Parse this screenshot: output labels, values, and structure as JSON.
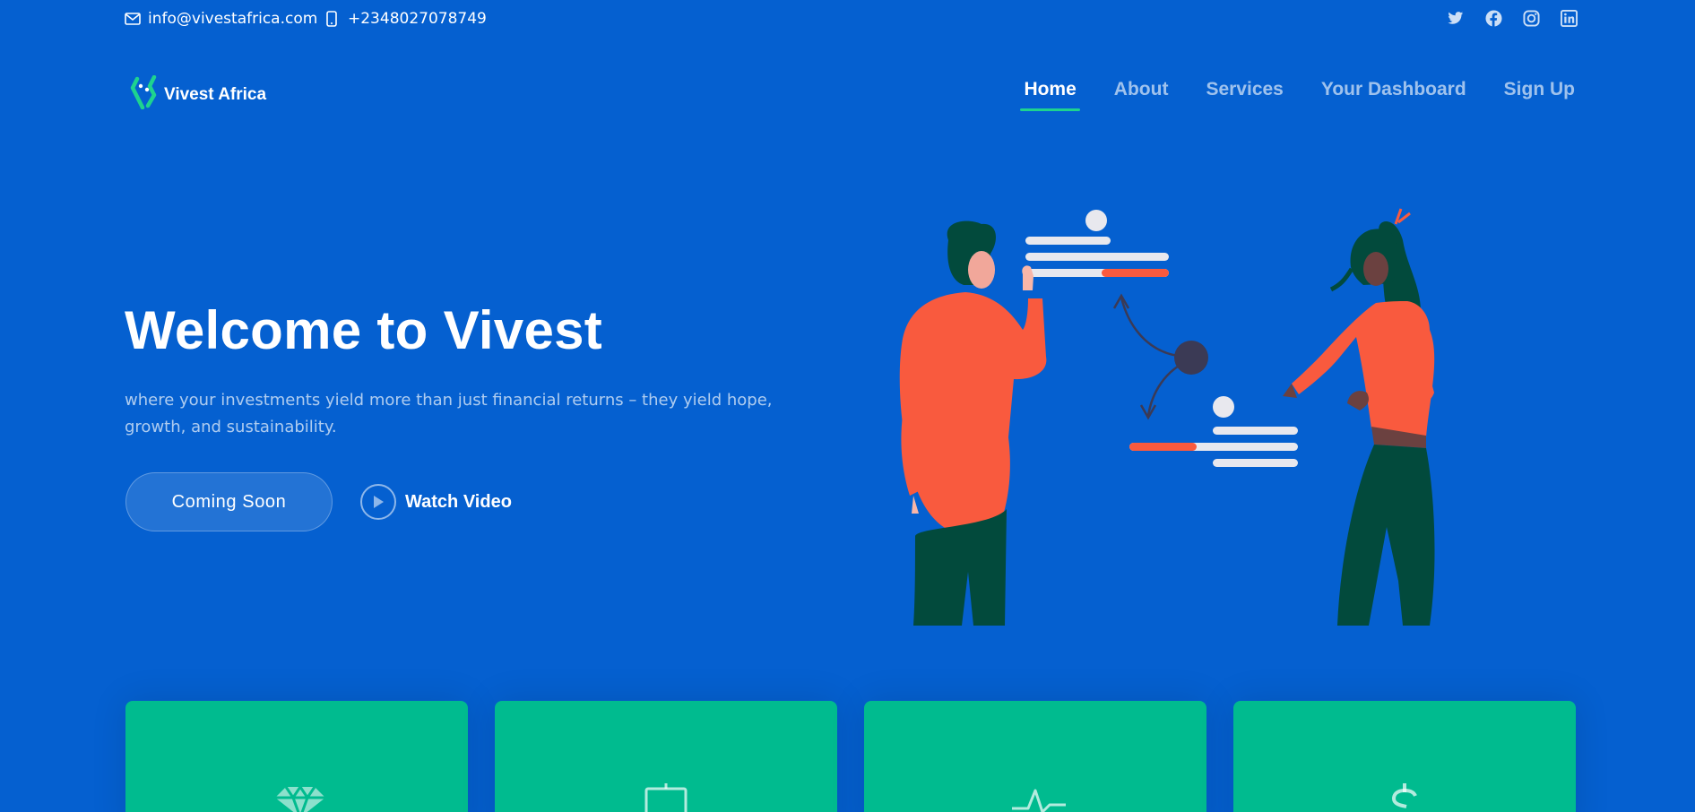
{
  "topbar": {
    "email": "info@vivestafrica.com",
    "phone": "+2348027078749",
    "email_icon": "envelope-icon",
    "phone_icon": "phone-icon",
    "socials": [
      "twitter-icon",
      "facebook-icon",
      "instagram-icon",
      "linkedin-icon"
    ]
  },
  "header": {
    "logo_text": "Vivest Africa",
    "nav": [
      {
        "label": "Home",
        "active": true
      },
      {
        "label": "About",
        "active": false
      },
      {
        "label": "Services",
        "active": false
      },
      {
        "label": "Your Dashboard",
        "active": false
      },
      {
        "label": "Sign Up",
        "active": false
      }
    ]
  },
  "hero": {
    "title": "Welcome to Vivest",
    "subtitle": "where your investments yield more than just financial returns – they yield hope, growth, and sustainability.",
    "primary_button": "Coming Soon",
    "video_button": "Watch Video"
  },
  "cards": [
    {
      "icon": "gem-icon"
    },
    {
      "icon": "easel-icon"
    },
    {
      "icon": "activity-icon"
    },
    {
      "icon": "dollar-icon"
    }
  ],
  "colors": {
    "background": "#0560d0",
    "accent": "#1ed38f",
    "card": "#00bb8f",
    "illustration_shirt": "#f95a3e",
    "illustration_pants": "#024a3c"
  }
}
